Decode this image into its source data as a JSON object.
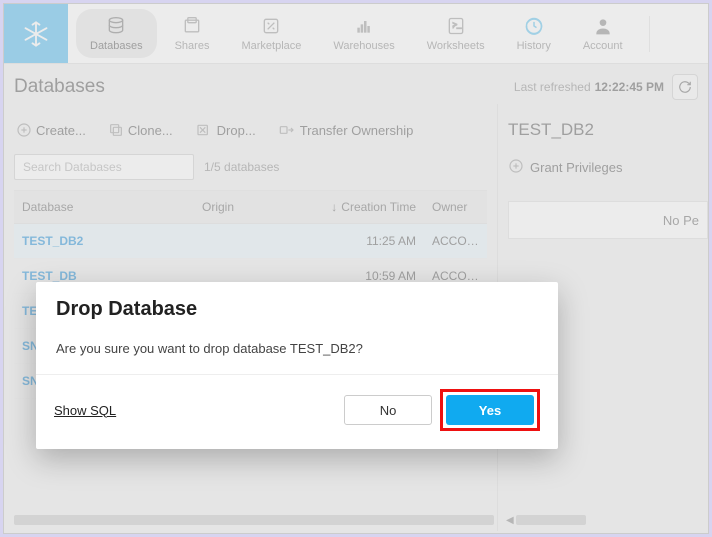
{
  "nav": {
    "items": [
      {
        "label": "Databases"
      },
      {
        "label": "Shares"
      },
      {
        "label": "Marketplace"
      },
      {
        "label": "Warehouses"
      },
      {
        "label": "Worksheets"
      },
      {
        "label": "History"
      },
      {
        "label": "Account"
      }
    ]
  },
  "header": {
    "title": "Databases",
    "last_refreshed_label": "Last refreshed",
    "last_refreshed_time": "12:22:45 PM"
  },
  "toolbar": {
    "create": "Create...",
    "clone": "Clone...",
    "drop": "Drop...",
    "transfer": "Transfer Ownership"
  },
  "search": {
    "placeholder": "Search Databases",
    "count": "1/5 databases"
  },
  "table": {
    "columns": {
      "name": "Database",
      "origin": "Origin",
      "ctime": "Creation Time",
      "owner": "Owner"
    },
    "rows": [
      {
        "name": "TEST_DB2",
        "origin": "",
        "ctime": "11:25 AM",
        "owner": "ACCOUNTAD"
      },
      {
        "name": "TEST_DB",
        "origin": "",
        "ctime": "10:59 AM",
        "owner": "ACCOUNTAD"
      },
      {
        "name": "TE",
        "origin": "",
        "ctime": "",
        "owner": ""
      },
      {
        "name": "SN",
        "origin": "",
        "ctime": "",
        "owner": ""
      },
      {
        "name": "SN",
        "origin": "",
        "ctime": "",
        "owner": ""
      }
    ]
  },
  "right": {
    "title": "TEST_DB2",
    "grant": "Grant Privileges",
    "priv_placeholder": "No Pe"
  },
  "modal": {
    "title": "Drop Database",
    "body": "Are you sure you want to drop database TEST_DB2?",
    "show_sql": "Show SQL",
    "no": "No",
    "yes": "Yes"
  }
}
